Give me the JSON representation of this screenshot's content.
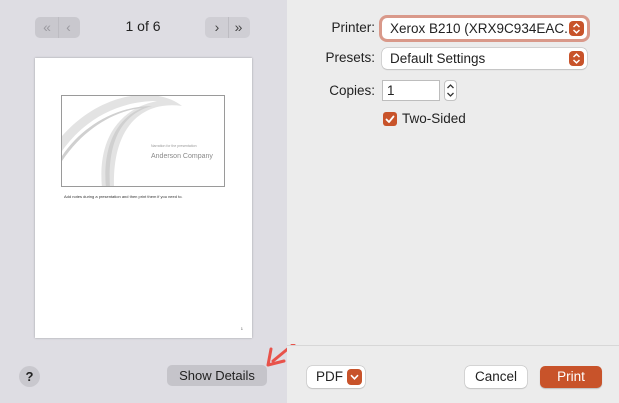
{
  "preview": {
    "first_page_icon": "first-page-icon",
    "prev_page_icon": "previous-page-icon",
    "next_page_icon": "next-page-icon",
    "last_page_icon": "last-page-icon",
    "page_counter": "1 of 6",
    "slide_caption": "Narration for the presentation",
    "slide_title": "Anderson Company",
    "notes_text": "Add notes during a presentation and then print them if you need to.",
    "page_number": "1",
    "help_label": "?",
    "show_details_label": "Show Details"
  },
  "settings": {
    "printer_label": "Printer:",
    "printer_value": "Xerox B210 (XRX9C934EAC...",
    "presets_label": "Presets:",
    "presets_value": "Default Settings",
    "copies_label": "Copies:",
    "copies_value": "1",
    "two_sided_label": "Two-Sided",
    "two_sided_checked": true
  },
  "footer": {
    "pdf_label": "PDF",
    "cancel_label": "Cancel",
    "print_label": "Print"
  },
  "colors": {
    "accent": "#c8532a",
    "annotation_arrow": "#e8524a"
  }
}
